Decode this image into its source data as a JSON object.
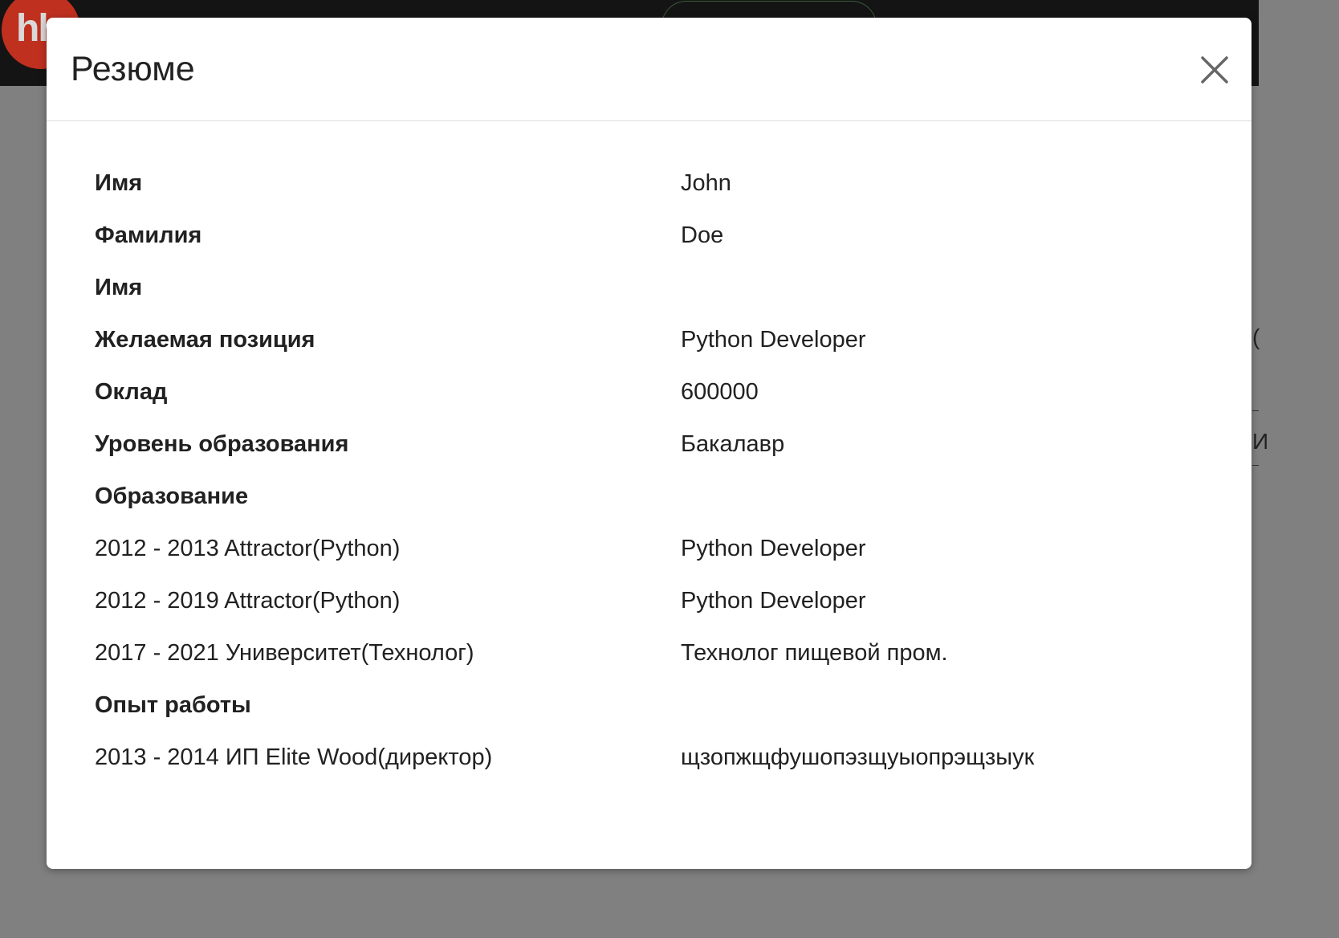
{
  "background": {
    "logo_text": "hh",
    "side_text_1": "(",
    "side_text_2": "И"
  },
  "modal": {
    "title": "Резюме",
    "close_icon": "close-icon"
  },
  "fields": [
    {
      "label": "Имя",
      "value": "John"
    },
    {
      "label": "Фамилия",
      "value": "Doe"
    },
    {
      "label": "Имя",
      "value": ""
    },
    {
      "label": "Желаемая позиция",
      "value": "Python Developer"
    },
    {
      "label": "Оклад",
      "value": "600000"
    },
    {
      "label": "Уровень образования",
      "value": "Бакалавр"
    }
  ],
  "education": {
    "heading": "Образование",
    "items": [
      {
        "period": "2012 - 2013 Attractor(Python)",
        "specialty": "Python Developer"
      },
      {
        "period": "2012 - 2019 Attractor(Python)",
        "specialty": "Python Developer"
      },
      {
        "period": "2017 - 2021 Университет(Технолог)",
        "specialty": "Технолог пищевой пром."
      }
    ]
  },
  "experience": {
    "heading": "Опыт работы",
    "items": [
      {
        "period": "2013 - 2014 ИП Elite Wood(директор)",
        "description": "щзопжщфушопэзщуыопрэщзыук"
      }
    ]
  }
}
